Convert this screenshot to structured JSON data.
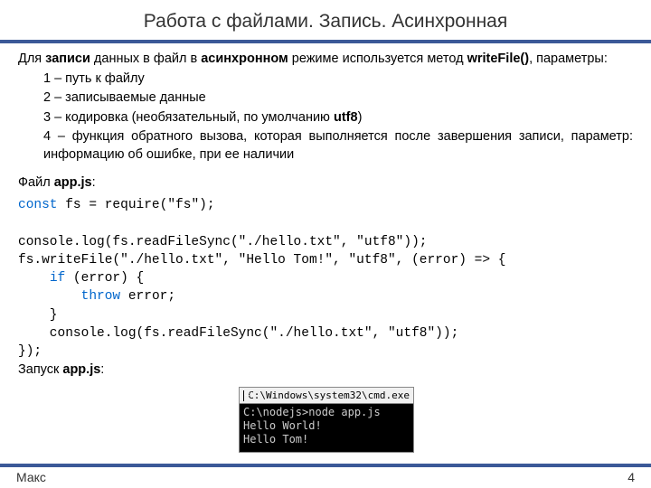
{
  "title": "Работа с файлами. Запись. Асинхронная",
  "intro": {
    "prefix": "Для ",
    "b1": "записи",
    "mid1": " данных в файл в ",
    "b2": "асинхронном",
    "mid2": " режиме используется метод ",
    "b3": "writeFile()",
    "suffix": ", параметры:"
  },
  "params": {
    "p1": "1 – путь к файлу",
    "p2": "2 – записываемые данные",
    "p3_a": "3 – кодировка (необязательный, по умолчанию ",
    "p3_b": "utf8",
    "p3_c": ")",
    "p4": "4 – функция обратного вызова, которая выполняется после завершения записи, параметр: информацию об ошибке, при ее наличии"
  },
  "file_label_a": "Файл ",
  "file_label_b": "app.js",
  "file_label_c": ":",
  "code": {
    "l1_kw": "const",
    "l1_rest": " fs = require(\"fs\");",
    "blank1": "",
    "l2": "console.log(fs.readFileSync(\"./hello.txt\", \"utf8\"));",
    "l3": "fs.writeFile(\"./hello.txt\", \"Hello Tom!\", \"utf8\", (error) => {",
    "l4_pad": "    ",
    "l4_kw": "if",
    "l4_rest": " (error) {",
    "l5_pad": "        ",
    "l5_kw": "throw",
    "l5_rest": " error;",
    "l6": "    }",
    "l7": "    console.log(fs.readFileSync(\"./hello.txt\", \"utf8\"));",
    "l8": "});"
  },
  "run_a": "Запуск ",
  "run_b": "app.js",
  "run_c": ":",
  "terminal": {
    "title": "C:\\Windows\\system32\\cmd.exe",
    "body": "C:\\nodejs>node app.js\nHello World!\nHello Tom!"
  },
  "footer": {
    "author": "Макс",
    "page": "4"
  }
}
